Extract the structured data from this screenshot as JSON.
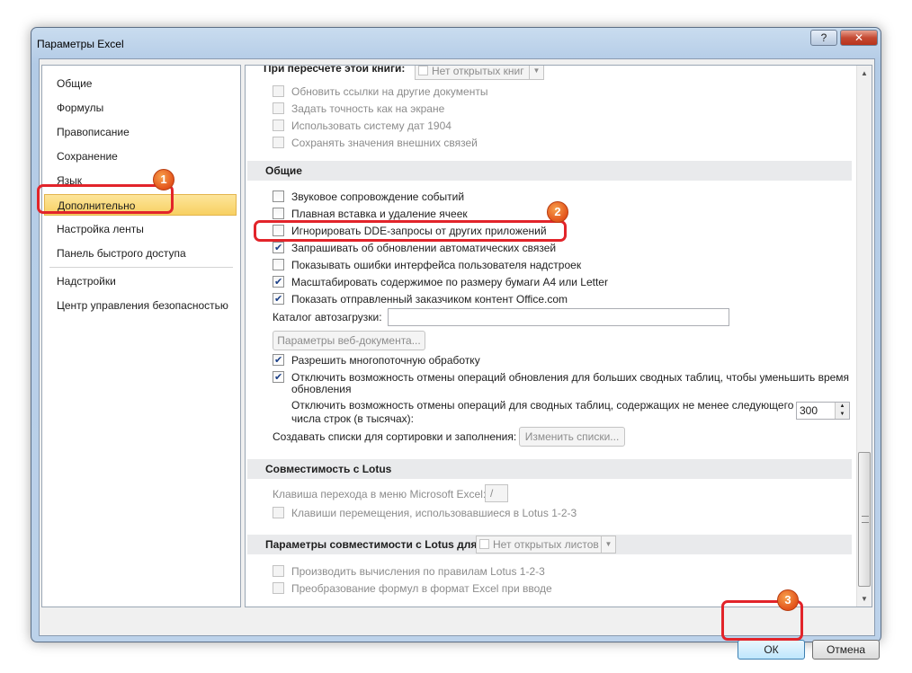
{
  "window": {
    "title": "Параметры Excel",
    "help_glyph": "?",
    "close_glyph": "✕"
  },
  "nav": {
    "items": [
      {
        "label": "Общие"
      },
      {
        "label": "Формулы"
      },
      {
        "label": "Правописание"
      },
      {
        "label": "Сохранение"
      },
      {
        "label": "Язык"
      },
      {
        "label": "Дополнительно",
        "selected": true
      },
      {
        "label": "Настройка ленты"
      },
      {
        "label": "Панель быстрого доступа"
      },
      {
        "label": "Надстройки"
      },
      {
        "label": "Центр управления безопасностью"
      }
    ]
  },
  "content": {
    "recalc_section": {
      "label": "При пересчете этой книги:",
      "combo_value": "Нет открытых книг",
      "items": [
        {
          "label": "Обновить ссылки на другие документы",
          "checked": false,
          "disabled": true
        },
        {
          "label": "Задать точность как на экране",
          "checked": false,
          "disabled": true
        },
        {
          "label": "Использовать систему дат 1904",
          "checked": false,
          "disabled": true
        },
        {
          "label": "Сохранять значения внешних связей",
          "checked": false,
          "disabled": true
        }
      ]
    },
    "general_section": {
      "header": "Общие",
      "items": [
        {
          "label": "Звуковое сопровождение событий",
          "checked": false
        },
        {
          "label": "Плавная вставка и удаление ячеек",
          "checked": false
        },
        {
          "label": "Игнорировать DDE-запросы от других приложений",
          "checked": false
        },
        {
          "label": "Запрашивать об обновлении автоматических связей",
          "checked": true
        },
        {
          "label": "Показывать ошибки интерфейса пользователя надстроек",
          "checked": false
        },
        {
          "label": "Масштабировать содержимое по размеру бумаги A4 или Letter",
          "checked": true
        },
        {
          "label": "Показать отправленный заказчиком контент Office.com",
          "checked": true
        }
      ],
      "startup_label": "Каталог автозагрузки:",
      "startup_value": "",
      "web_options_button": "Параметры веб-документа...",
      "multithread_label": "Разрешить многопоточную обработку",
      "multithread_checked": true,
      "undo_large_label": "Отключить возможность отмены операций обновления для больших сводных таблиц, чтобы уменьшить время",
      "undo_large_label_2": "обновления",
      "undo_large_checked": true,
      "undo_rows_label": "Отключить возможность отмены операций для сводных таблиц, содержащих не менее следующего",
      "undo_rows_label_2": "числа строк (в тысячах):",
      "undo_rows_value": "300",
      "lists_label": "Создавать списки для сортировки и заполнения:",
      "lists_button": "Изменить списки..."
    },
    "lotus_section": {
      "header": "Совместимость с Lotus",
      "menu_key_label": "Клавиша перехода в меню Microsoft Excel:",
      "menu_key_value": "/",
      "nav_keys_label": "Клавиши перемещения, использовавшиеся в Lotus 1-2-3"
    },
    "lotus_compat_section": {
      "header": "Параметры совместимости с Lotus для:",
      "combo_value": "Нет открытых листов",
      "items": [
        {
          "label": "Производить вычисления по правилам Lotus 1-2-3"
        },
        {
          "label": "Преобразование формул в формат Excel при вводе"
        }
      ]
    }
  },
  "footer": {
    "ok_label": "ОК",
    "cancel_label": "Отмена"
  },
  "annotations": {
    "badge_1": "1",
    "badge_2": "2",
    "badge_3": "3",
    "color": "#e2242a"
  }
}
